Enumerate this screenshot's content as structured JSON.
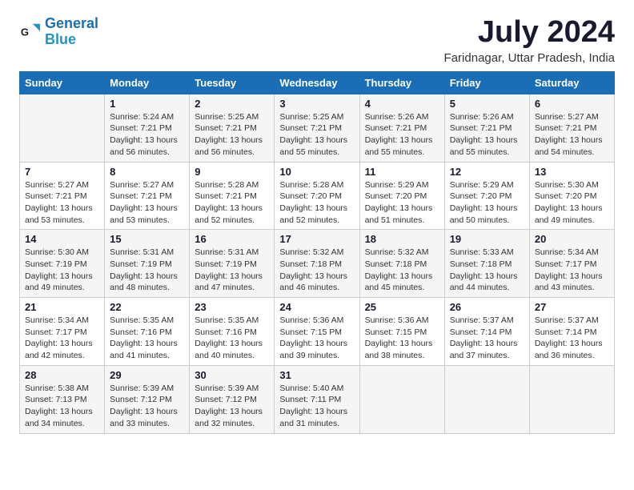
{
  "logo": {
    "line1": "General",
    "line2": "Blue"
  },
  "title": {
    "month_year": "July 2024",
    "location": "Faridnagar, Uttar Pradesh, India"
  },
  "header_days": [
    "Sunday",
    "Monday",
    "Tuesday",
    "Wednesday",
    "Thursday",
    "Friday",
    "Saturday"
  ],
  "weeks": [
    [
      {
        "day": "",
        "info": ""
      },
      {
        "day": "1",
        "info": "Sunrise: 5:24 AM\nSunset: 7:21 PM\nDaylight: 13 hours\nand 56 minutes."
      },
      {
        "day": "2",
        "info": "Sunrise: 5:25 AM\nSunset: 7:21 PM\nDaylight: 13 hours\nand 56 minutes."
      },
      {
        "day": "3",
        "info": "Sunrise: 5:25 AM\nSunset: 7:21 PM\nDaylight: 13 hours\nand 55 minutes."
      },
      {
        "day": "4",
        "info": "Sunrise: 5:26 AM\nSunset: 7:21 PM\nDaylight: 13 hours\nand 55 minutes."
      },
      {
        "day": "5",
        "info": "Sunrise: 5:26 AM\nSunset: 7:21 PM\nDaylight: 13 hours\nand 55 minutes."
      },
      {
        "day": "6",
        "info": "Sunrise: 5:27 AM\nSunset: 7:21 PM\nDaylight: 13 hours\nand 54 minutes."
      }
    ],
    [
      {
        "day": "7",
        "info": "Sunrise: 5:27 AM\nSunset: 7:21 PM\nDaylight: 13 hours\nand 53 minutes."
      },
      {
        "day": "8",
        "info": "Sunrise: 5:27 AM\nSunset: 7:21 PM\nDaylight: 13 hours\nand 53 minutes."
      },
      {
        "day": "9",
        "info": "Sunrise: 5:28 AM\nSunset: 7:21 PM\nDaylight: 13 hours\nand 52 minutes."
      },
      {
        "day": "10",
        "info": "Sunrise: 5:28 AM\nSunset: 7:20 PM\nDaylight: 13 hours\nand 52 minutes."
      },
      {
        "day": "11",
        "info": "Sunrise: 5:29 AM\nSunset: 7:20 PM\nDaylight: 13 hours\nand 51 minutes."
      },
      {
        "day": "12",
        "info": "Sunrise: 5:29 AM\nSunset: 7:20 PM\nDaylight: 13 hours\nand 50 minutes."
      },
      {
        "day": "13",
        "info": "Sunrise: 5:30 AM\nSunset: 7:20 PM\nDaylight: 13 hours\nand 49 minutes."
      }
    ],
    [
      {
        "day": "14",
        "info": "Sunrise: 5:30 AM\nSunset: 7:19 PM\nDaylight: 13 hours\nand 49 minutes."
      },
      {
        "day": "15",
        "info": "Sunrise: 5:31 AM\nSunset: 7:19 PM\nDaylight: 13 hours\nand 48 minutes."
      },
      {
        "day": "16",
        "info": "Sunrise: 5:31 AM\nSunset: 7:19 PM\nDaylight: 13 hours\nand 47 minutes."
      },
      {
        "day": "17",
        "info": "Sunrise: 5:32 AM\nSunset: 7:18 PM\nDaylight: 13 hours\nand 46 minutes."
      },
      {
        "day": "18",
        "info": "Sunrise: 5:32 AM\nSunset: 7:18 PM\nDaylight: 13 hours\nand 45 minutes."
      },
      {
        "day": "19",
        "info": "Sunrise: 5:33 AM\nSunset: 7:18 PM\nDaylight: 13 hours\nand 44 minutes."
      },
      {
        "day": "20",
        "info": "Sunrise: 5:34 AM\nSunset: 7:17 PM\nDaylight: 13 hours\nand 43 minutes."
      }
    ],
    [
      {
        "day": "21",
        "info": "Sunrise: 5:34 AM\nSunset: 7:17 PM\nDaylight: 13 hours\nand 42 minutes."
      },
      {
        "day": "22",
        "info": "Sunrise: 5:35 AM\nSunset: 7:16 PM\nDaylight: 13 hours\nand 41 minutes."
      },
      {
        "day": "23",
        "info": "Sunrise: 5:35 AM\nSunset: 7:16 PM\nDaylight: 13 hours\nand 40 minutes."
      },
      {
        "day": "24",
        "info": "Sunrise: 5:36 AM\nSunset: 7:15 PM\nDaylight: 13 hours\nand 39 minutes."
      },
      {
        "day": "25",
        "info": "Sunrise: 5:36 AM\nSunset: 7:15 PM\nDaylight: 13 hours\nand 38 minutes."
      },
      {
        "day": "26",
        "info": "Sunrise: 5:37 AM\nSunset: 7:14 PM\nDaylight: 13 hours\nand 37 minutes."
      },
      {
        "day": "27",
        "info": "Sunrise: 5:37 AM\nSunset: 7:14 PM\nDaylight: 13 hours\nand 36 minutes."
      }
    ],
    [
      {
        "day": "28",
        "info": "Sunrise: 5:38 AM\nSunset: 7:13 PM\nDaylight: 13 hours\nand 34 minutes."
      },
      {
        "day": "29",
        "info": "Sunrise: 5:39 AM\nSunset: 7:12 PM\nDaylight: 13 hours\nand 33 minutes."
      },
      {
        "day": "30",
        "info": "Sunrise: 5:39 AM\nSunset: 7:12 PM\nDaylight: 13 hours\nand 32 minutes."
      },
      {
        "day": "31",
        "info": "Sunrise: 5:40 AM\nSunset: 7:11 PM\nDaylight: 13 hours\nand 31 minutes."
      },
      {
        "day": "",
        "info": ""
      },
      {
        "day": "",
        "info": ""
      },
      {
        "day": "",
        "info": ""
      }
    ]
  ]
}
